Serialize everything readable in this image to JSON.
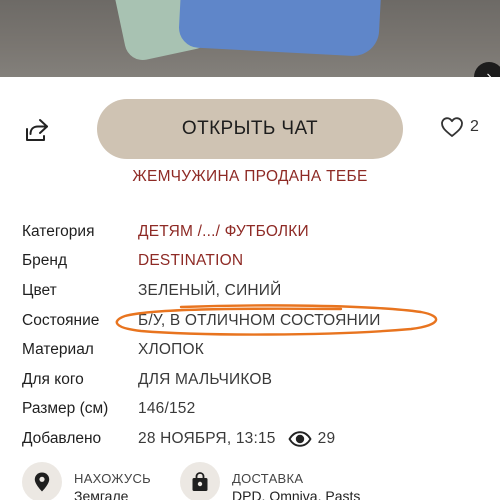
{
  "actions": {
    "chat_label": "ОТКРЫТЬ ЧАТ",
    "favorites_count": "2"
  },
  "sold_note": "ЖЕМЧУЖИНА ПРОДАНА ТЕБЕ",
  "details": {
    "category": {
      "label": "Категория",
      "value": "ДЕТЯМ /.../ ФУТБОЛКИ"
    },
    "brand": {
      "label": "Бренд",
      "value": "DESTINATION"
    },
    "color": {
      "label": "Цвет",
      "value": "ЗЕЛЕНЫЙ, СИНИЙ"
    },
    "condition": {
      "label": "Состояние",
      "value": "Б/У, В ОТЛИЧНОМ СОСТОЯНИИ"
    },
    "material": {
      "label": "Материал",
      "value": "ХЛОПОК"
    },
    "audience": {
      "label": "Для кого",
      "value": "ДЛЯ МАЛЬЧИКОВ"
    },
    "size": {
      "label": "Размер (см)",
      "value": "146/152"
    },
    "added": {
      "label": "Добавлено",
      "value": "28 НОЯБРЯ, 13:15",
      "views": "29"
    }
  },
  "info": {
    "location": {
      "title": "НАХОЖУСЬ",
      "value": "Земгале"
    },
    "delivery": {
      "title": "ДОСТАВКА",
      "value": "DPD, Omniva, Pasts"
    }
  },
  "colors": {
    "accent": "#8e2a25",
    "chat_button": "#cfc3b3",
    "highlight": "#e8741f",
    "info_circle": "#ece8e3"
  },
  "icons": {
    "share": "share-icon",
    "favorite": "heart-icon",
    "views": "eye-icon",
    "location": "map-pin-icon",
    "delivery": "shopping-bag-icon",
    "next": "chevron-right-icon"
  }
}
